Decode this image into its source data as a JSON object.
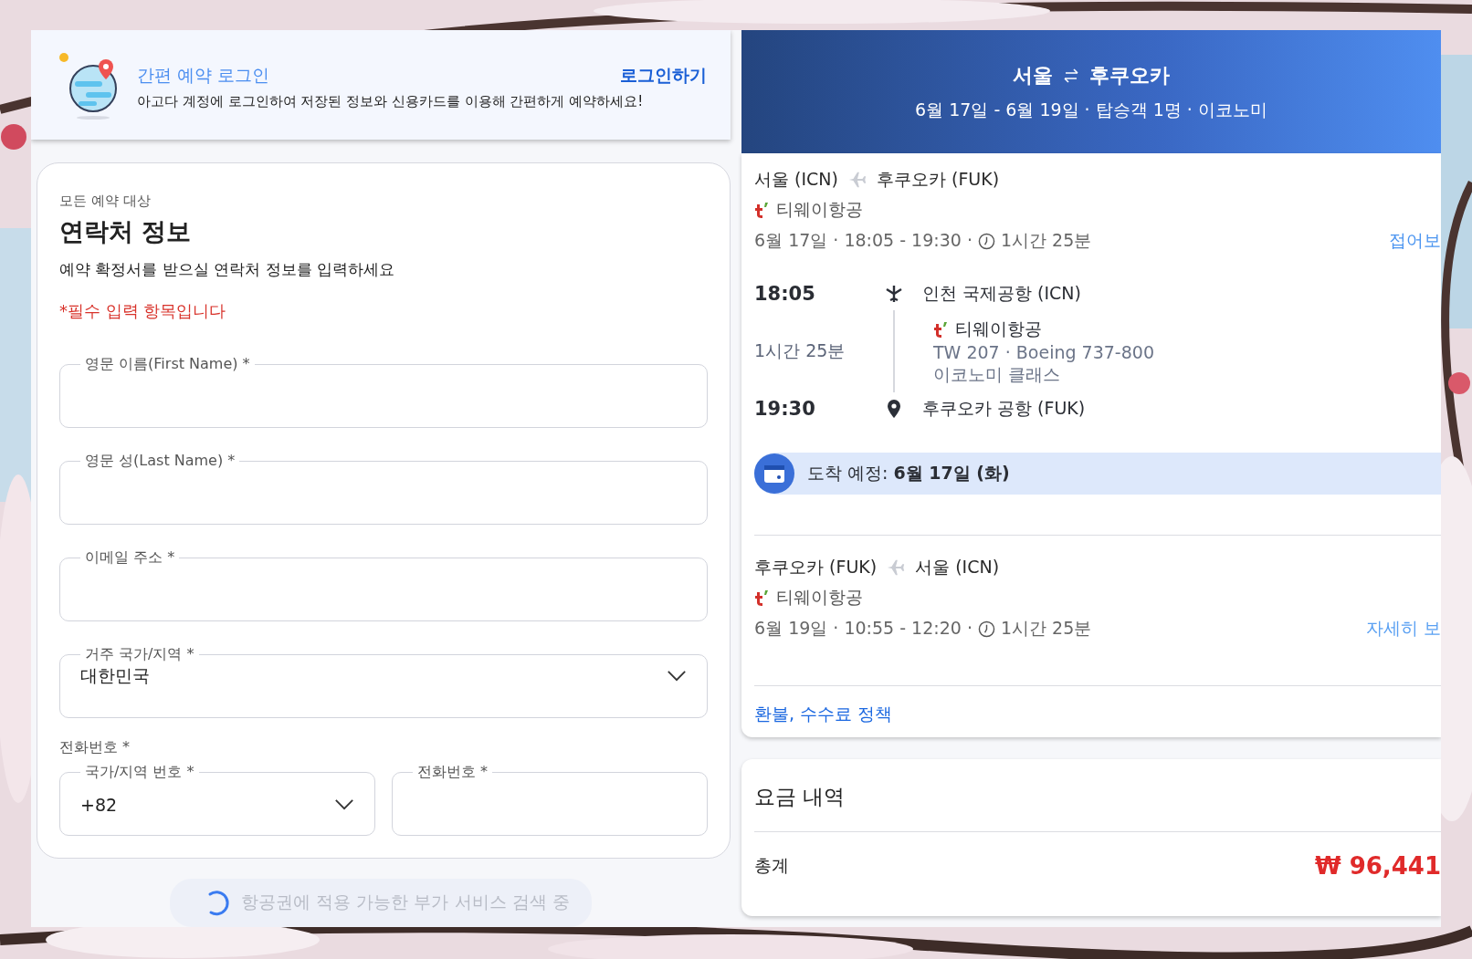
{
  "login_banner": {
    "title": "간편 예약 로그인",
    "description": "아고다 계정에 로그인하여 저장된 정보와 신용카드를 이용해 간편하게 예약하세요!",
    "login_link": "로그인하기"
  },
  "contact_form": {
    "eyebrow": "모든 예약 대상",
    "title": "연락처 정보",
    "subtitle": "예약 확정서를 받으실 연락처 정보를 입력하세요",
    "required_note": "*필수 입력 항목입니다",
    "fields": [
      {
        "kind": "text",
        "label": "영문 이름(First Name) *"
      },
      {
        "kind": "text",
        "label": "영문 성(Last Name) *"
      },
      {
        "kind": "text",
        "label": "이메일 주소 *"
      },
      {
        "kind": "select",
        "label": "거주 국가/지역 *",
        "value": "대한민국"
      }
    ],
    "phone": {
      "label": "전화번호 *",
      "fields": [
        {
          "kind": "select",
          "label": "국가/지역 번호 *",
          "value": "+82"
        },
        {
          "kind": "text",
          "label": "전화번호 *"
        }
      ]
    }
  },
  "loading_notice": {
    "text": "항공권에 적용 가능한 부가 서비스 검색 중"
  },
  "trip_header": {
    "origin": "서울",
    "destination": "후쿠오카",
    "summary": "6월 17일 - 6월 19일 · 탑승객 1명 · 이코노미"
  },
  "segments": [
    {
      "expanded": true,
      "origin": "서울 (ICN)",
      "destination": "후쿠오카 (FUK)",
      "airline": "티웨이항공",
      "schedule": "6월 17일 · 18:05 - 19:30 ·",
      "duration": "1시간 25분",
      "toggle": "접어보",
      "details": {
        "departure_time": "18:05",
        "departure_airport": "인천 국제공항 (ICN)",
        "duration": "1시간 25분",
        "airline": "티웨이항공",
        "flight": "TW 207 · Boeing 737-800",
        "cabin": "이코노미 클래스",
        "arrival_time": "19:30",
        "arrival_airport": "후쿠오카 공항 (FUK)",
        "arrival_note": "도착 예정:  **6월 17일 (화)**"
      }
    },
    {
      "expanded": false,
      "origin": "후쿠오카 (FUK)",
      "destination": "서울 (ICN)",
      "airline": "티웨이항공",
      "schedule": "6월 19일 · 10:55 - 12:20 ·",
      "duration": "1시간 25분",
      "toggle": "자세히 보"
    }
  ],
  "policy_link": "환불, 수수료 정책",
  "price_summary": {
    "title": "요금 내역",
    "total_label": "총계",
    "total": "₩ 96,441"
  }
}
